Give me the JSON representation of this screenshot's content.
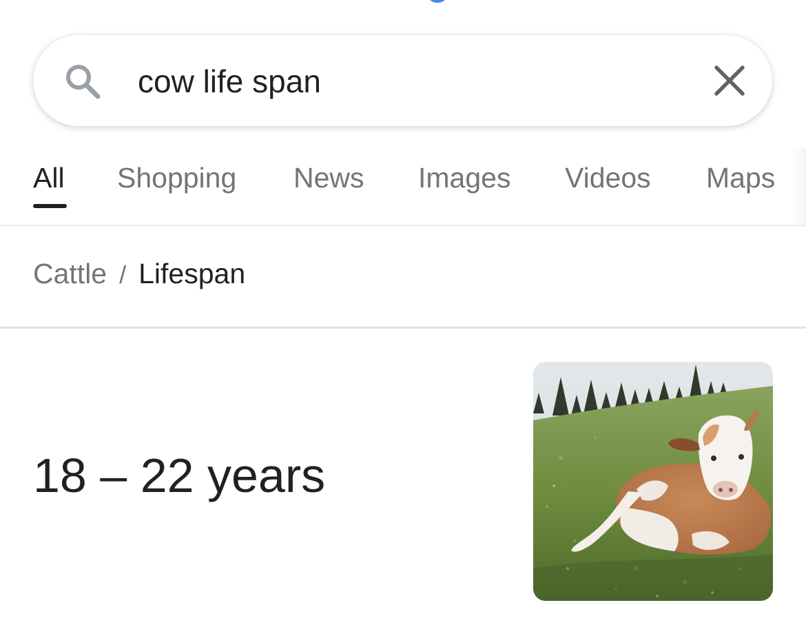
{
  "search": {
    "query": "cow life span"
  },
  "tabs": [
    {
      "label": "All",
      "active": true
    },
    {
      "label": "Shopping",
      "active": false
    },
    {
      "label": "News",
      "active": false
    },
    {
      "label": "Images",
      "active": false
    },
    {
      "label": "Videos",
      "active": false
    },
    {
      "label": "Maps",
      "active": false
    }
  ],
  "breadcrumb": {
    "parent": "Cattle",
    "separator": "/",
    "current": "Lifespan"
  },
  "answer": {
    "value": "18 – 22 years"
  },
  "icons": {
    "search": "search-icon",
    "clear": "close-icon"
  },
  "colors": {
    "accent": "#4285f4",
    "primary_text": "#202124",
    "secondary_text": "#70757a"
  }
}
